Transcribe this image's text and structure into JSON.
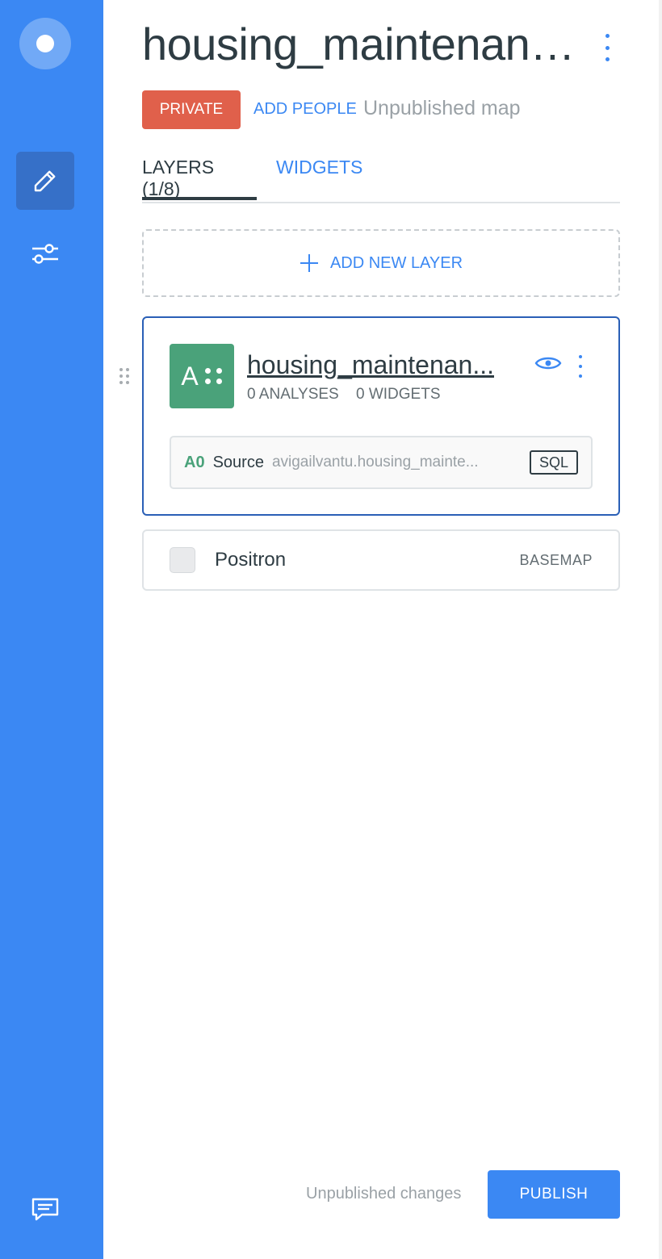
{
  "header": {
    "title": "housing_maintenanc...",
    "privacy_badge": "PRIVATE",
    "add_people_label": "ADD PEOPLE",
    "status_text": "Unpublished map"
  },
  "tabs": [
    {
      "label": "LAYERS (1/8)",
      "active": true
    },
    {
      "label": "WIDGETS",
      "active": false
    }
  ],
  "add_layer": {
    "label": "ADD NEW LAYER",
    "icon": "plus-icon"
  },
  "layer": {
    "thumb_letter": "A",
    "name": "housing_maintenan...",
    "analyses": "0 ANALYSES",
    "widgets": "0 WIDGETS",
    "source": {
      "id": "A0",
      "label": "Source",
      "name": "avigailvantu.housing_mainte...",
      "sql_label": "SQL"
    }
  },
  "basemap": {
    "name": "Positron",
    "tag": "BASEMAP"
  },
  "footer": {
    "status_text": "Unpublished changes",
    "publish_label": "PUBLISH"
  },
  "colors": {
    "rail": "#3b88f3",
    "accent": "#3b88f3",
    "private": "#e0604b",
    "layer_thumb": "#4aa27a",
    "active_border": "#2a5fb6"
  }
}
